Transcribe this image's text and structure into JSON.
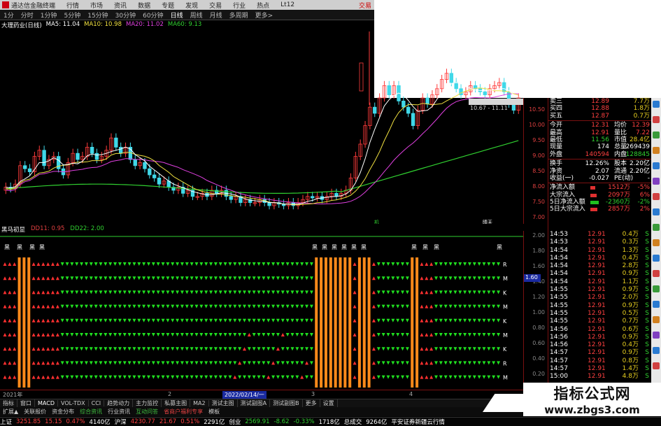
{
  "app": {
    "title": "通达信金融终端",
    "menus": [
      "行情",
      "市场",
      "资讯",
      "数据",
      "专题",
      "发现",
      "交易",
      "行业",
      "热点",
      "Lt12"
    ],
    "right_link": "交易"
  },
  "periods": [
    "1分",
    "分时",
    "1分钟",
    "5分钟",
    "15分钟",
    "30分钟",
    "60分钟",
    "日线",
    "周线",
    "月线",
    "多周期",
    "更多>"
  ],
  "active_period": "日线",
  "stock": {
    "name": "大理药业(日线)"
  },
  "ma_legend": [
    {
      "label": "MA5: 11.04",
      "color": "#ffffff"
    },
    {
      "label": "MA10: 10.98",
      "color": "#f0e040"
    },
    {
      "label": "MA20: 11.02",
      "color": "#e040e0"
    },
    {
      "label": "MA60: 9.13",
      "color": "#30d030"
    }
  ],
  "price_axis": [
    "10.50",
    "10.00",
    "9.50",
    "9.00",
    "8.50",
    "8.00",
    "7.50",
    "7.00"
  ],
  "price_overlay": "10.67 - 11.11",
  "marks": [
    "晴天",
    "机"
  ],
  "indicator": {
    "name": "黑马初显",
    "dd11": "DD11: 0.95",
    "dd22": "DD22: 2.00",
    "heima_label": "黑",
    "signal_labels": [
      "R",
      "M",
      "K",
      "M",
      "K",
      "M",
      "K",
      "R",
      "M",
      "K"
    ],
    "axis": [
      "2.00",
      "1.80",
      "1.60",
      "1.40",
      "1.20",
      "1.00",
      "0.80",
      "0.60",
      "0.40",
      "0.20"
    ],
    "cursor_value": "1.60"
  },
  "dates": {
    "left": "2021年",
    "cursor": "2022/02/14/一",
    "marks": [
      "2",
      "3",
      "4"
    ]
  },
  "indicator_tabs": [
    "指标",
    "窗口",
    "MACD",
    "VOL-TDX",
    "CCI",
    "趋势动力",
    "主力监控",
    "私募主图",
    "MA2",
    "测试主图",
    "测试副图A",
    "测试副图B",
    "更多",
    "设置"
  ],
  "sub_tabs": [
    {
      "label": "扩展▲",
      "cls": ""
    },
    {
      "label": "关联报价",
      "cls": ""
    },
    {
      "label": "资金分布",
      "cls": ""
    },
    {
      "label": "综合资讯",
      "cls": "hl"
    },
    {
      "label": "行业资讯",
      "cls": ""
    },
    {
      "label": "互动问答",
      "cls": "hl"
    },
    {
      "label": "省商户福利专享",
      "cls": "red"
    },
    {
      "label": "模板",
      "cls": ""
    }
  ],
  "status": [
    {
      "label": "上证",
      "cls": "wh"
    },
    {
      "label": "3251.85",
      "cls": "up"
    },
    {
      "label": "15.15",
      "cls": "up"
    },
    {
      "label": "0.47%",
      "cls": "up"
    },
    {
      "label": "4140亿",
      "cls": "wh"
    },
    {
      "label": "沪深",
      "cls": "wh"
    },
    {
      "label": "4230.77",
      "cls": "up"
    },
    {
      "label": "21.67",
      "cls": "up"
    },
    {
      "label": "0.51%",
      "cls": "up"
    },
    {
      "label": "2291亿",
      "cls": "wh"
    },
    {
      "label": "创业",
      "cls": "wh"
    },
    {
      "label": "2569.91",
      "cls": "dn"
    },
    {
      "label": "-8.62",
      "cls": "dn"
    },
    {
      "label": "-0.33%",
      "cls": "dn"
    },
    {
      "label": "1718亿",
      "cls": "wh"
    },
    {
      "label": "总成交",
      "cls": "wh"
    },
    {
      "label": "9264亿",
      "cls": "wh"
    },
    {
      "label": "平安证券新疆云行情",
      "cls": "wh"
    }
  ],
  "quote_top": [
    {
      "k": "卖三",
      "v": "12.89",
      "q": "7.7万"
    },
    {
      "k": "买四",
      "v": "12.88",
      "q": "1.8万"
    },
    {
      "k": "买五",
      "v": "12.87",
      "q": "0.7万"
    }
  ],
  "quote_stats": [
    [
      {
        "t": "今开",
        "c": "wh"
      },
      {
        "t": "12.31",
        "c": "up"
      },
      {
        "t": "均价",
        "c": "wh"
      },
      {
        "t": "12.39",
        "c": "up"
      }
    ],
    [
      {
        "t": "最高",
        "c": "wh"
      },
      {
        "t": "12.91",
        "c": "up"
      },
      {
        "t": "量比",
        "c": "wh"
      },
      {
        "t": "7.22",
        "c": "up"
      }
    ],
    [
      {
        "t": "最低",
        "c": "wh"
      },
      {
        "t": "11.56",
        "c": "dn"
      },
      {
        "t": "市值",
        "c": "wh"
      },
      {
        "t": "28.4亿",
        "c": "yl"
      }
    ],
    [
      {
        "t": "现量",
        "c": "wh"
      },
      {
        "t": "174",
        "c": "wh"
      },
      {
        "t": "总量",
        "c": "wh"
      },
      {
        "t": "269439",
        "c": "wh"
      }
    ],
    [
      {
        "t": "外盘",
        "c": "wh"
      },
      {
        "t": "140594",
        "c": "up"
      },
      {
        "t": "内盘",
        "c": "wh"
      },
      {
        "t": "128845",
        "c": "dn"
      }
    ]
  ],
  "quote_stats2": [
    [
      {
        "t": "换手",
        "c": "wh"
      },
      {
        "t": "12.26%",
        "c": "wh"
      },
      {
        "t": "股本",
        "c": "wh"
      },
      {
        "t": "2.20亿",
        "c": "wh"
      }
    ],
    [
      {
        "t": "净资",
        "c": "wh"
      },
      {
        "t": "2.07",
        "c": "wh"
      },
      {
        "t": "流通",
        "c": "wh"
      },
      {
        "t": "2.20亿",
        "c": "wh"
      }
    ],
    [
      {
        "t": "收益(一)",
        "c": "wh"
      },
      {
        "t": "-0.027",
        "c": "wh"
      },
      {
        "t": "PE(动)",
        "c": "wh"
      },
      {
        "t": "-",
        "c": "wh"
      }
    ]
  ],
  "flows": [
    {
      "k": "净流入额",
      "v": "1512万",
      "p": "-5%",
      "g": false,
      "w": 0.35
    },
    {
      "k": "大宗流入",
      "v": "2097万",
      "p": "6%",
      "g": false,
      "w": 0.45
    },
    {
      "k": "5日净流入额",
      "v": "-2360万",
      "p": "-2%",
      "g": true,
      "w": 0.6
    },
    {
      "k": "5日大宗流入",
      "v": "2857万",
      "p": "2%",
      "g": false,
      "w": 0.5
    }
  ],
  "ticks": [
    {
      "t": "14:53",
      "p": "12.91",
      "v": "0.4万",
      "s": "S"
    },
    {
      "t": "14:53",
      "p": "12.91",
      "v": "0.3万",
      "s": "S"
    },
    {
      "t": "14:54",
      "p": "12.91",
      "v": "1.3万",
      "s": "S"
    },
    {
      "t": "14:54",
      "p": "12.91",
      "v": "0.4万",
      "s": "S"
    },
    {
      "t": "14:54",
      "p": "12.91",
      "v": "2.8万",
      "s": "S"
    },
    {
      "t": "14:54",
      "p": "12.91",
      "v": "0.9万",
      "s": "S"
    },
    {
      "t": "14:54",
      "p": "12.91",
      "v": "1.1万",
      "s": "S"
    },
    {
      "t": "14:55",
      "p": "12.91",
      "v": "0.9万",
      "s": "S"
    },
    {
      "t": "14:55",
      "p": "12.91",
      "v": "2.0万",
      "s": "S"
    },
    {
      "t": "14:55",
      "p": "12.91",
      "v": "0.9万",
      "s": "S"
    },
    {
      "t": "14:55",
      "p": "12.91",
      "v": "0.5万",
      "s": "S"
    },
    {
      "t": "14:55",
      "p": "12.91",
      "v": "0.7万",
      "s": "S"
    },
    {
      "t": "14:56",
      "p": "12.91",
      "v": "0.6万",
      "s": "S"
    },
    {
      "t": "14:56",
      "p": "12.91",
      "v": "0.9万",
      "s": "S"
    },
    {
      "t": "14:56",
      "p": "12.91",
      "v": "0.4万",
      "s": "S"
    },
    {
      "t": "14:57",
      "p": "12.91",
      "v": "0.9万",
      "s": "S"
    },
    {
      "t": "14:57",
      "p": "12.91",
      "v": "0.8万",
      "s": "S"
    },
    {
      "t": "14:57",
      "p": "12.91",
      "v": "1.4万",
      "s": "S"
    },
    {
      "t": "15:00",
      "p": "12.91",
      "v": "4.8万",
      "s": "S"
    }
  ],
  "watermark": {
    "line1": "指标公式网",
    "line2": "www.zbgs3.com"
  },
  "sidebar_icons": [
    "#2a7ad0",
    "#d04040",
    "#3a9a3a",
    "#d08020",
    "#2a7ad0",
    "#8040c0",
    "#d04040",
    "#2a7ad0",
    "#3a9a3a",
    "#d08020",
    "#2a7ad0",
    "#d04040",
    "#3a9a3a",
    "#2a7ad0",
    "#d08020",
    "#8040c0",
    "#2a7ad0",
    "#d04040"
  ]
}
